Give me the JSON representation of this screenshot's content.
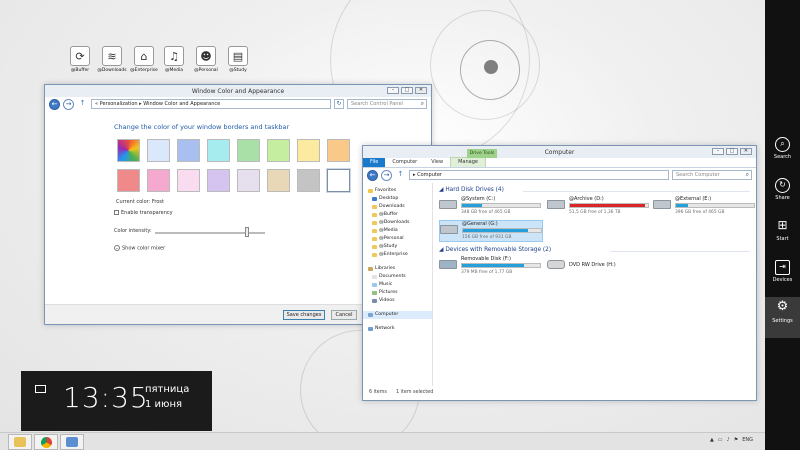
{
  "desktop": {
    "icons": [
      {
        "label": "@Buffer",
        "glyph": "⟳"
      },
      {
        "label": "@Downloads",
        "glyph": "≋"
      },
      {
        "label": "@Enterprise",
        "glyph": "⌂"
      },
      {
        "label": "@Media",
        "glyph": "♫"
      },
      {
        "label": "@Personal",
        "glyph": "☻"
      },
      {
        "label": "@Study",
        "glyph": "▤"
      }
    ]
  },
  "color_window": {
    "title": "Window Color and Appearance",
    "address": "« Personalization  ▸  Window Color and Appearance",
    "search_placeholder": "Search Control Panel",
    "heading": "Change the color of your window borders and taskbar",
    "swatches_row1": [
      "#5a7cc0",
      "#dbe7fb",
      "#a8bff0",
      "#a6ecee",
      "#a8e0a8",
      "#c5eea1",
      "#fbeaa0",
      "#f9c98a"
    ],
    "swatches_row2": [
      "#f08a8a",
      "#f6a9cf",
      "#fadcf0",
      "#d6c4f0",
      "#e6e0ee",
      "#e8d8b8",
      "#c4c4c4",
      "#ffffff"
    ],
    "current_color_label": "Current color: Frost",
    "enable_transparency": "Enable transparency",
    "color_intensity": "Color intensity:",
    "show_color_mixer": "Show color mixer",
    "save_label": "Save changes",
    "cancel_label": "Cancel",
    "intensity_value": 0.84
  },
  "explorer": {
    "title": "Computer",
    "context_tab": "Drive Tools",
    "tabs": [
      "File",
      "Computer",
      "View",
      "Manage"
    ],
    "address": "Computer",
    "search_placeholder": "Search Computer",
    "nav": {
      "favorites_header": "Favorites",
      "favorites": [
        "Desktop",
        "Downloads",
        "@Buffer",
        "@Downloads",
        "@Media",
        "@Personal",
        "@Study",
        "@Enterprise"
      ],
      "libraries_header": "Libraries",
      "libraries": [
        "Documents",
        "Music",
        "Pictures",
        "Videos"
      ],
      "computer": "Computer",
      "network": "Network"
    },
    "hard_disk_header": "Hard Disk Drives (4)",
    "removable_header": "Devices with Removable Storage (2)",
    "drives": [
      {
        "name": "@System (C:)",
        "free": "348 GB free of 465 GB",
        "used": 0.25,
        "warn": false
      },
      {
        "name": "@Archive (D:)",
        "free": "51,5 GB free of 1,36 TB",
        "used": 0.96,
        "warn": true
      },
      {
        "name": "@External (E:)",
        "free": "396 GB free of 465 GB",
        "used": 0.15,
        "warn": false
      },
      {
        "name": "@General (G:)",
        "free": "156 GB free of 931 GB",
        "used": 0.83,
        "warn": false
      }
    ],
    "removable": [
      {
        "name": "Removable Disk (F:)",
        "free": "379 MB free of 1,77 GB",
        "used": 0.79
      },
      {
        "name": "DVD RW Drive (H:)",
        "free": "",
        "used": null
      }
    ],
    "status_items": "6 items",
    "status_selected": "1 item selected"
  },
  "clock": {
    "time": "13:35",
    "day": "пятница",
    "date": "1 июня"
  },
  "charms": [
    {
      "label": "Search",
      "glyph": "⌕"
    },
    {
      "label": "Share",
      "glyph": "↻"
    },
    {
      "label": "Start",
      "glyph": "⊞"
    },
    {
      "label": "Devices",
      "glyph": "⇥"
    },
    {
      "label": "Settings",
      "glyph": "⚙"
    }
  ],
  "taskbar": {
    "lang": "ENG"
  }
}
